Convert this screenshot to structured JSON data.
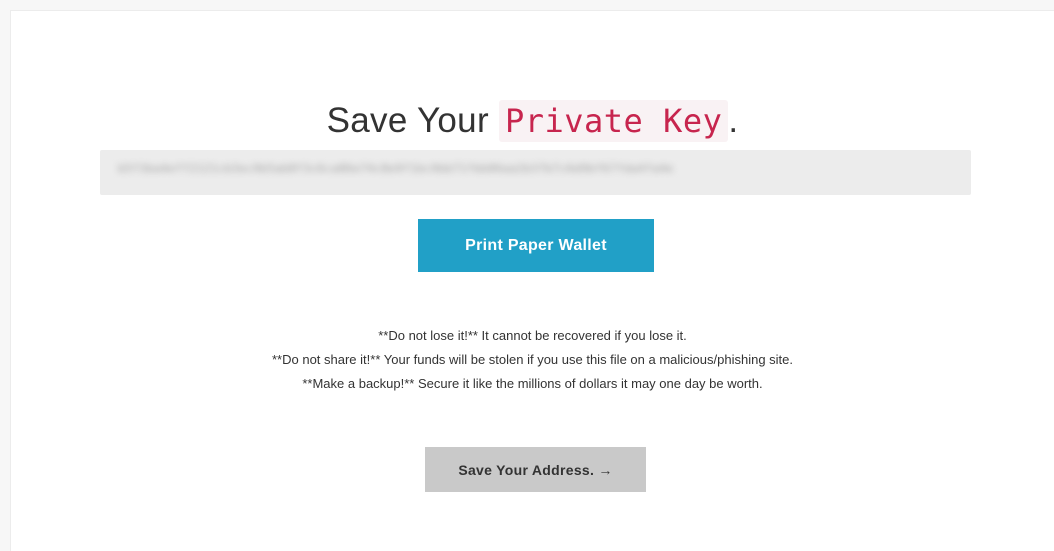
{
  "heading": {
    "prefix": "Save Your",
    "highlight": "Private Key",
    "suffix": "."
  },
  "private_key": {
    "value": "b5f3ba4eff2121cb3ec9b5ab8f3c6ca86e74c8e9f1bc9bb71fbb06aa2b37b7c6d9bf67fda4fa4e"
  },
  "buttons": {
    "print_label": "Print Paper Wallet",
    "next_label": "Save Your Address. →"
  },
  "warnings": [
    "**Do not lose it!** It cannot be recovered if you lose it.",
    "**Do not share it!** Your funds will be stolen if you use this file on a malicious/phishing site.",
    "**Make a backup!** Secure it like the millions of dollars it may one day be worth."
  ]
}
